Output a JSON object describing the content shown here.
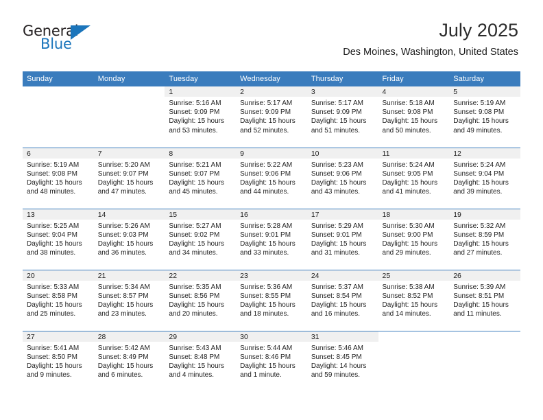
{
  "brand": {
    "name_top": "General",
    "name_bottom": "Blue",
    "accent_color": "#1b75bb"
  },
  "header": {
    "month_title": "July 2025",
    "location": "Des Moines, Washington, United States"
  },
  "theme": {
    "header_blue": "#3a7cbd",
    "daynum_band_gray": "#f0f0f0"
  },
  "calendar": {
    "weekday_headers": [
      "Sunday",
      "Monday",
      "Tuesday",
      "Wednesday",
      "Thursday",
      "Friday",
      "Saturday"
    ],
    "weeks": [
      [
        {
          "day": "",
          "sunrise": "",
          "sunset": "",
          "daylight_line1": "",
          "daylight_line2": ""
        },
        {
          "day": "",
          "sunrise": "",
          "sunset": "",
          "daylight_line1": "",
          "daylight_line2": ""
        },
        {
          "day": "1",
          "sunrise": "Sunrise: 5:16 AM",
          "sunset": "Sunset: 9:09 PM",
          "daylight_line1": "Daylight: 15 hours",
          "daylight_line2": "and 53 minutes."
        },
        {
          "day": "2",
          "sunrise": "Sunrise: 5:17 AM",
          "sunset": "Sunset: 9:09 PM",
          "daylight_line1": "Daylight: 15 hours",
          "daylight_line2": "and 52 minutes."
        },
        {
          "day": "3",
          "sunrise": "Sunrise: 5:17 AM",
          "sunset": "Sunset: 9:09 PM",
          "daylight_line1": "Daylight: 15 hours",
          "daylight_line2": "and 51 minutes."
        },
        {
          "day": "4",
          "sunrise": "Sunrise: 5:18 AM",
          "sunset": "Sunset: 9:08 PM",
          "daylight_line1": "Daylight: 15 hours",
          "daylight_line2": "and 50 minutes."
        },
        {
          "day": "5",
          "sunrise": "Sunrise: 5:19 AM",
          "sunset": "Sunset: 9:08 PM",
          "daylight_line1": "Daylight: 15 hours",
          "daylight_line2": "and 49 minutes."
        }
      ],
      [
        {
          "day": "6",
          "sunrise": "Sunrise: 5:19 AM",
          "sunset": "Sunset: 9:08 PM",
          "daylight_line1": "Daylight: 15 hours",
          "daylight_line2": "and 48 minutes."
        },
        {
          "day": "7",
          "sunrise": "Sunrise: 5:20 AM",
          "sunset": "Sunset: 9:07 PM",
          "daylight_line1": "Daylight: 15 hours",
          "daylight_line2": "and 47 minutes."
        },
        {
          "day": "8",
          "sunrise": "Sunrise: 5:21 AM",
          "sunset": "Sunset: 9:07 PM",
          "daylight_line1": "Daylight: 15 hours",
          "daylight_line2": "and 45 minutes."
        },
        {
          "day": "9",
          "sunrise": "Sunrise: 5:22 AM",
          "sunset": "Sunset: 9:06 PM",
          "daylight_line1": "Daylight: 15 hours",
          "daylight_line2": "and 44 minutes."
        },
        {
          "day": "10",
          "sunrise": "Sunrise: 5:23 AM",
          "sunset": "Sunset: 9:06 PM",
          "daylight_line1": "Daylight: 15 hours",
          "daylight_line2": "and 43 minutes."
        },
        {
          "day": "11",
          "sunrise": "Sunrise: 5:24 AM",
          "sunset": "Sunset: 9:05 PM",
          "daylight_line1": "Daylight: 15 hours",
          "daylight_line2": "and 41 minutes."
        },
        {
          "day": "12",
          "sunrise": "Sunrise: 5:24 AM",
          "sunset": "Sunset: 9:04 PM",
          "daylight_line1": "Daylight: 15 hours",
          "daylight_line2": "and 39 minutes."
        }
      ],
      [
        {
          "day": "13",
          "sunrise": "Sunrise: 5:25 AM",
          "sunset": "Sunset: 9:04 PM",
          "daylight_line1": "Daylight: 15 hours",
          "daylight_line2": "and 38 minutes."
        },
        {
          "day": "14",
          "sunrise": "Sunrise: 5:26 AM",
          "sunset": "Sunset: 9:03 PM",
          "daylight_line1": "Daylight: 15 hours",
          "daylight_line2": "and 36 minutes."
        },
        {
          "day": "15",
          "sunrise": "Sunrise: 5:27 AM",
          "sunset": "Sunset: 9:02 PM",
          "daylight_line1": "Daylight: 15 hours",
          "daylight_line2": "and 34 minutes."
        },
        {
          "day": "16",
          "sunrise": "Sunrise: 5:28 AM",
          "sunset": "Sunset: 9:01 PM",
          "daylight_line1": "Daylight: 15 hours",
          "daylight_line2": "and 33 minutes."
        },
        {
          "day": "17",
          "sunrise": "Sunrise: 5:29 AM",
          "sunset": "Sunset: 9:01 PM",
          "daylight_line1": "Daylight: 15 hours",
          "daylight_line2": "and 31 minutes."
        },
        {
          "day": "18",
          "sunrise": "Sunrise: 5:30 AM",
          "sunset": "Sunset: 9:00 PM",
          "daylight_line1": "Daylight: 15 hours",
          "daylight_line2": "and 29 minutes."
        },
        {
          "day": "19",
          "sunrise": "Sunrise: 5:32 AM",
          "sunset": "Sunset: 8:59 PM",
          "daylight_line1": "Daylight: 15 hours",
          "daylight_line2": "and 27 minutes."
        }
      ],
      [
        {
          "day": "20",
          "sunrise": "Sunrise: 5:33 AM",
          "sunset": "Sunset: 8:58 PM",
          "daylight_line1": "Daylight: 15 hours",
          "daylight_line2": "and 25 minutes."
        },
        {
          "day": "21",
          "sunrise": "Sunrise: 5:34 AM",
          "sunset": "Sunset: 8:57 PM",
          "daylight_line1": "Daylight: 15 hours",
          "daylight_line2": "and 23 minutes."
        },
        {
          "day": "22",
          "sunrise": "Sunrise: 5:35 AM",
          "sunset": "Sunset: 8:56 PM",
          "daylight_line1": "Daylight: 15 hours",
          "daylight_line2": "and 20 minutes."
        },
        {
          "day": "23",
          "sunrise": "Sunrise: 5:36 AM",
          "sunset": "Sunset: 8:55 PM",
          "daylight_line1": "Daylight: 15 hours",
          "daylight_line2": "and 18 minutes."
        },
        {
          "day": "24",
          "sunrise": "Sunrise: 5:37 AM",
          "sunset": "Sunset: 8:54 PM",
          "daylight_line1": "Daylight: 15 hours",
          "daylight_line2": "and 16 minutes."
        },
        {
          "day": "25",
          "sunrise": "Sunrise: 5:38 AM",
          "sunset": "Sunset: 8:52 PM",
          "daylight_line1": "Daylight: 15 hours",
          "daylight_line2": "and 14 minutes."
        },
        {
          "day": "26",
          "sunrise": "Sunrise: 5:39 AM",
          "sunset": "Sunset: 8:51 PM",
          "daylight_line1": "Daylight: 15 hours",
          "daylight_line2": "and 11 minutes."
        }
      ],
      [
        {
          "day": "27",
          "sunrise": "Sunrise: 5:41 AM",
          "sunset": "Sunset: 8:50 PM",
          "daylight_line1": "Daylight: 15 hours",
          "daylight_line2": "and 9 minutes."
        },
        {
          "day": "28",
          "sunrise": "Sunrise: 5:42 AM",
          "sunset": "Sunset: 8:49 PM",
          "daylight_line1": "Daylight: 15 hours",
          "daylight_line2": "and 6 minutes."
        },
        {
          "day": "29",
          "sunrise": "Sunrise: 5:43 AM",
          "sunset": "Sunset: 8:48 PM",
          "daylight_line1": "Daylight: 15 hours",
          "daylight_line2": "and 4 minutes."
        },
        {
          "day": "30",
          "sunrise": "Sunrise: 5:44 AM",
          "sunset": "Sunset: 8:46 PM",
          "daylight_line1": "Daylight: 15 hours",
          "daylight_line2": "and 1 minute."
        },
        {
          "day": "31",
          "sunrise": "Sunrise: 5:46 AM",
          "sunset": "Sunset: 8:45 PM",
          "daylight_line1": "Daylight: 14 hours",
          "daylight_line2": "and 59 minutes."
        },
        {
          "day": "",
          "sunrise": "",
          "sunset": "",
          "daylight_line1": "",
          "daylight_line2": ""
        },
        {
          "day": "",
          "sunrise": "",
          "sunset": "",
          "daylight_line1": "",
          "daylight_line2": ""
        }
      ]
    ]
  }
}
